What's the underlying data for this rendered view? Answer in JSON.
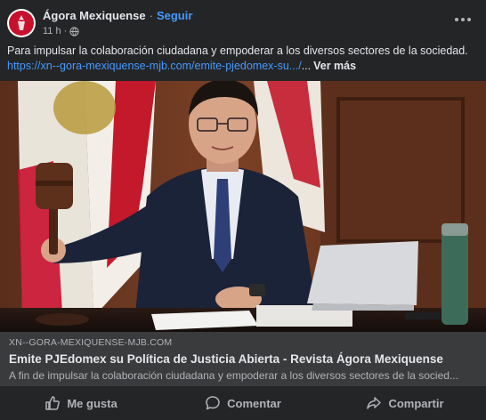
{
  "post": {
    "author": "Ágora Mexiquense",
    "separator": "·",
    "follow_label": "Seguir",
    "time": "11 h",
    "time_separator": "·",
    "audience_icon": "globe-icon",
    "more_icon": "more-options-icon",
    "text": "Para impulsar la colaboración ciudadana y empoderar a los diversos sectores de la sociedad.",
    "link_text": "https://xn--gora-mexiquense-mjb.com/emite-pjedomex-su.../",
    "ellipsis": "...",
    "see_more_label": "Ver más"
  },
  "link_preview": {
    "domain": "XN--GORA-MEXIQUENSE-MJB.COM",
    "title": "Emite PJEdomex su Política de Justicia Abierta - Revista Ágora Mexiquense",
    "description": "A fin de impulsar la colaboración ciudadana y empoderar a los diversos sectores de la socied..."
  },
  "actions": {
    "like_label": "Me gusta",
    "comment_label": "Comentar",
    "share_label": "Compartir"
  },
  "colors": {
    "background": "#242526",
    "link": "#4599ff",
    "preview_bg": "#3a3b3c",
    "avatar_red": "#c8102e"
  }
}
